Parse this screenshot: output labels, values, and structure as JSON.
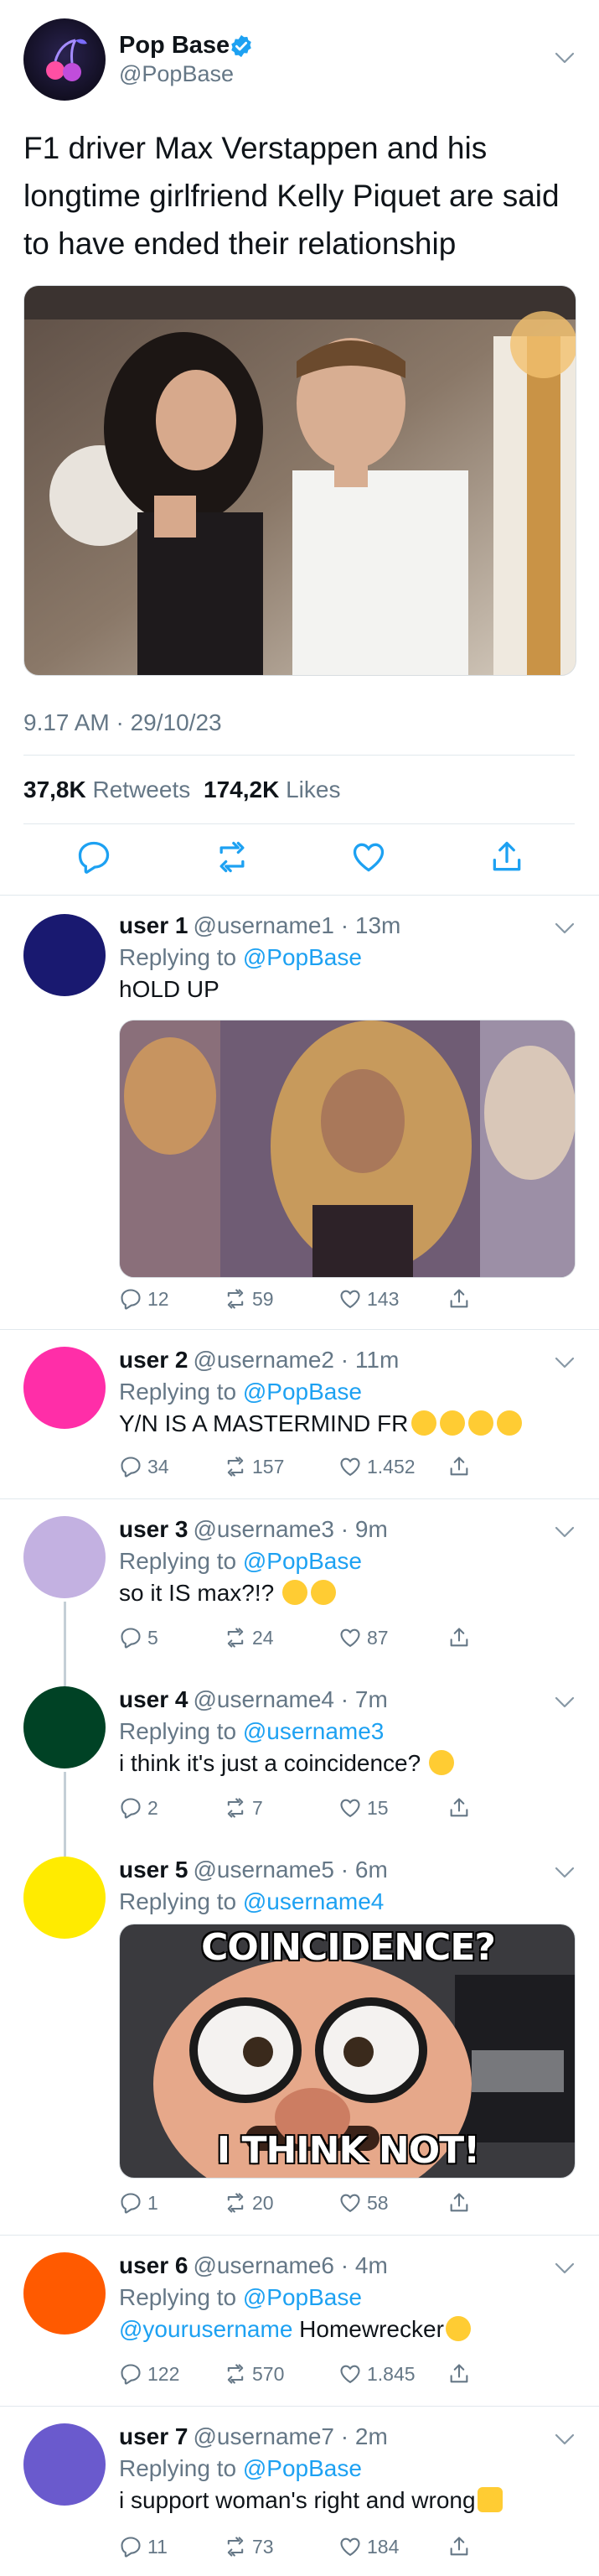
{
  "main": {
    "name": "Pop Base",
    "handle": "@PopBase",
    "text": "F1 driver Max Verstappen and his longtime girlfriend Kelly Piquet are said to have ended their relationship",
    "timestamp": "9.17 AM · 29/10/23",
    "retweets_count": "37,8K",
    "retweets_label": "Retweets",
    "likes_count": "174,2K",
    "likes_label": "Likes"
  },
  "replies": [
    {
      "name": "user 1",
      "handle": "@username1 · 13m",
      "replying_prefix": "Replying to ",
      "replying_to": "@PopBase",
      "text": "hOLD UP",
      "replies": "12",
      "retweets": "59",
      "likes": "143",
      "avatar_color": "#191970"
    },
    {
      "name": "user 2",
      "handle": "@username2 · 11m",
      "replying_prefix": "Replying to ",
      "replying_to": "@PopBase",
      "text": "Y/N IS A MASTERMIND FR",
      "replies": "34",
      "retweets": "157",
      "likes": "1.452",
      "avatar_color": "#ff2ea8"
    },
    {
      "name": "user 3",
      "handle": "@username3 · 9m",
      "replying_prefix": "Replying to ",
      "replying_to": "@PopBase",
      "text": "so it IS max?!?",
      "replies": "5",
      "retweets": "24",
      "likes": "87",
      "avatar_color": "#c3b1e1"
    },
    {
      "name": "user 4",
      "handle": "@username4 · 7m",
      "replying_prefix": "Replying to ",
      "replying_to": "@username3",
      "text": "i think it's just a coincidence?",
      "replies": "2",
      "retweets": "7",
      "likes": "15",
      "avatar_color": "#004225"
    },
    {
      "name": "user 5",
      "handle": "@username5 · 6m",
      "replying_prefix": "Replying to ",
      "replying_to": "@username4",
      "text": "",
      "replies": "1",
      "retweets": "20",
      "likes": "58",
      "avatar_color": "#ffeb00",
      "meme_top": "COINCIDENCE?",
      "meme_bottom": "I THINK NOT!"
    },
    {
      "name": "user 6",
      "handle": "@username6 · 4m",
      "replying_prefix": "Replying to ",
      "replying_to": "@PopBase",
      "mention": "@yourusername",
      "text": " Homewrecker",
      "replies": "122",
      "retweets": "570",
      "likes": "1.845",
      "avatar_color": "#ff5a00"
    },
    {
      "name": "user 7",
      "handle": "@username7 · 2m",
      "replying_prefix": "Replying to ",
      "replying_to": "@PopBase",
      "text": "i support woman's right and wrong",
      "replies": "11",
      "retweets": "73",
      "likes": "184",
      "avatar_color": "#6a5acd"
    }
  ],
  "colors": {
    "link": "#1da1f2",
    "secondary_text": "#657786",
    "divider": "#e1e8ed"
  }
}
